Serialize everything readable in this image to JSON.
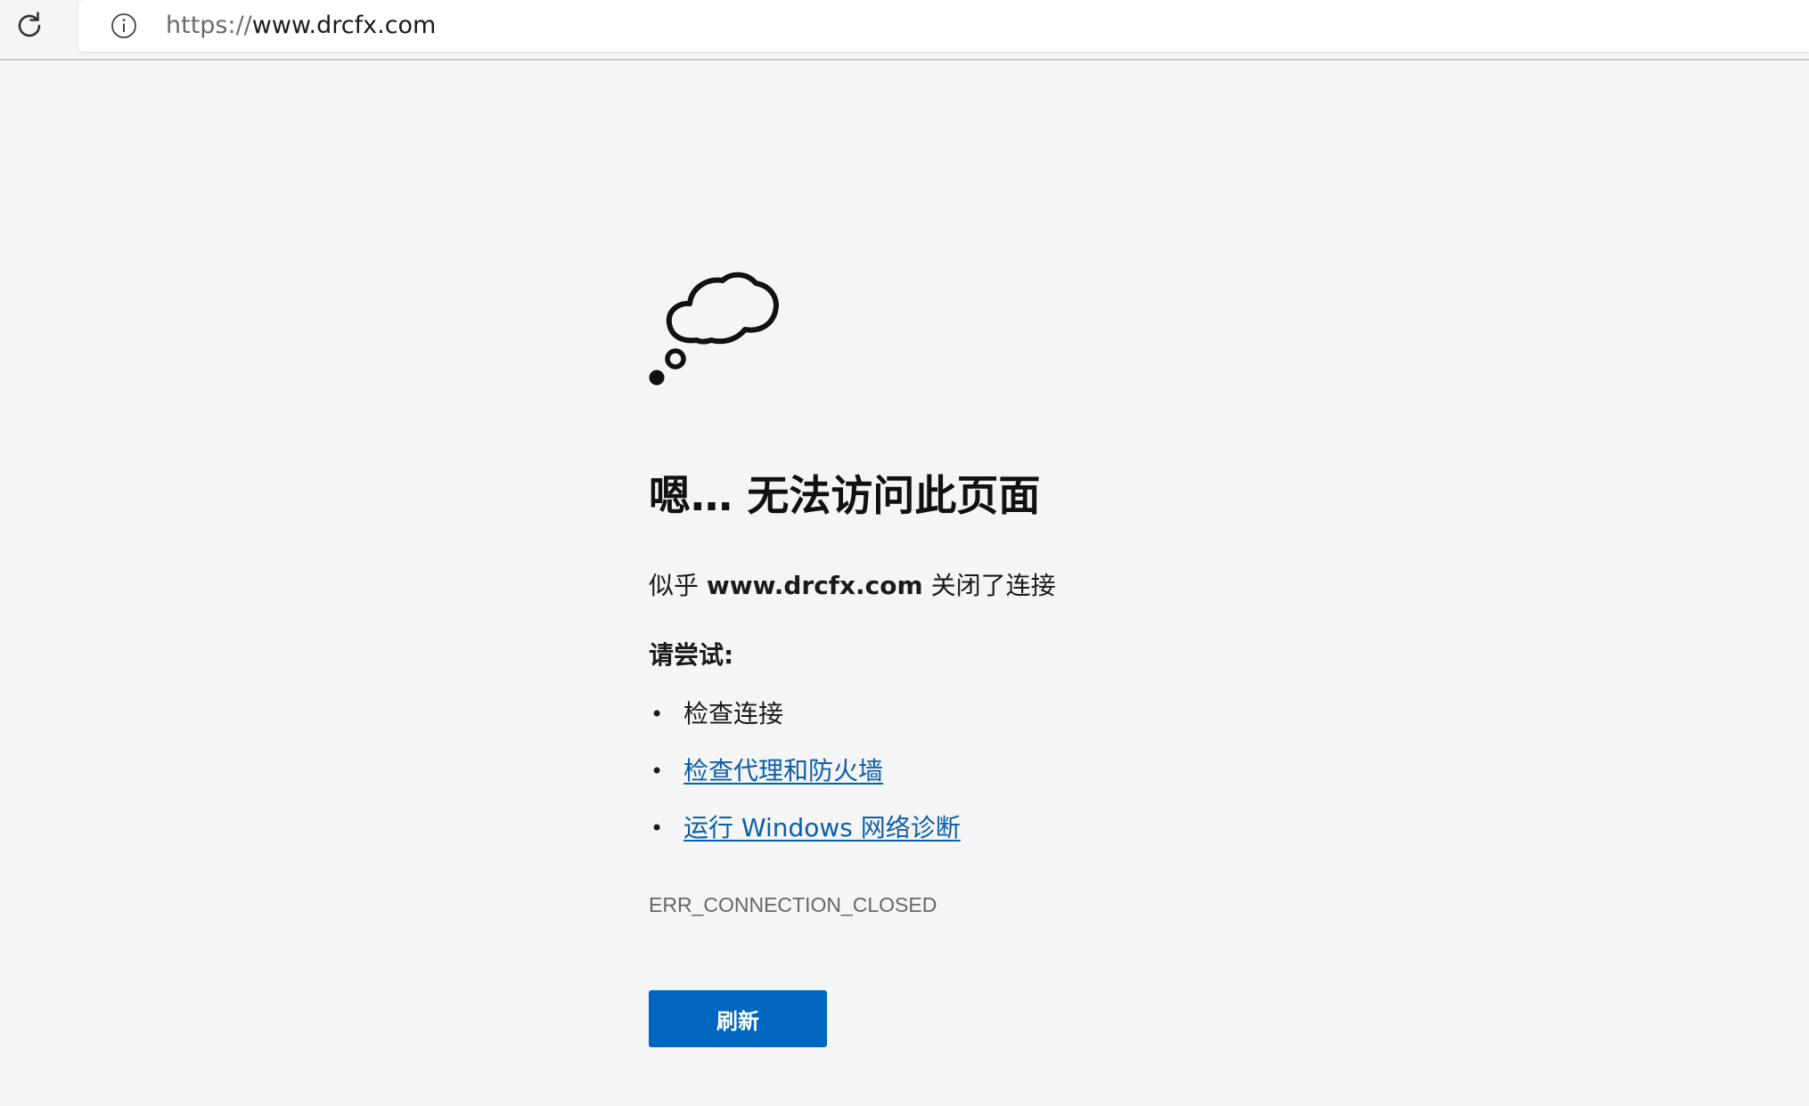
{
  "browser": {
    "url_scheme": "https://",
    "url_host": "www.drcfx.com",
    "reload_icon": "reload-icon",
    "info_icon": "info-icon"
  },
  "error_page": {
    "icon": "thought-cloud-icon",
    "heading": "嗯… 无法访问此页面",
    "desc_prefix": "似乎 ",
    "desc_host": "www.drcfx.com",
    "desc_suffix": " 关闭了连接",
    "try_label": "请尝试:",
    "suggestions": [
      {
        "text": "检查连接",
        "is_link": false
      },
      {
        "text": "检查代理和防火墙",
        "is_link": true
      },
      {
        "text": "运行 Windows 网络诊断",
        "is_link": true
      }
    ],
    "error_code": "ERR_CONNECTION_CLOSED",
    "refresh_label": "刷新",
    "accent_color": "#0067c0",
    "link_color": "#0a5faa"
  }
}
